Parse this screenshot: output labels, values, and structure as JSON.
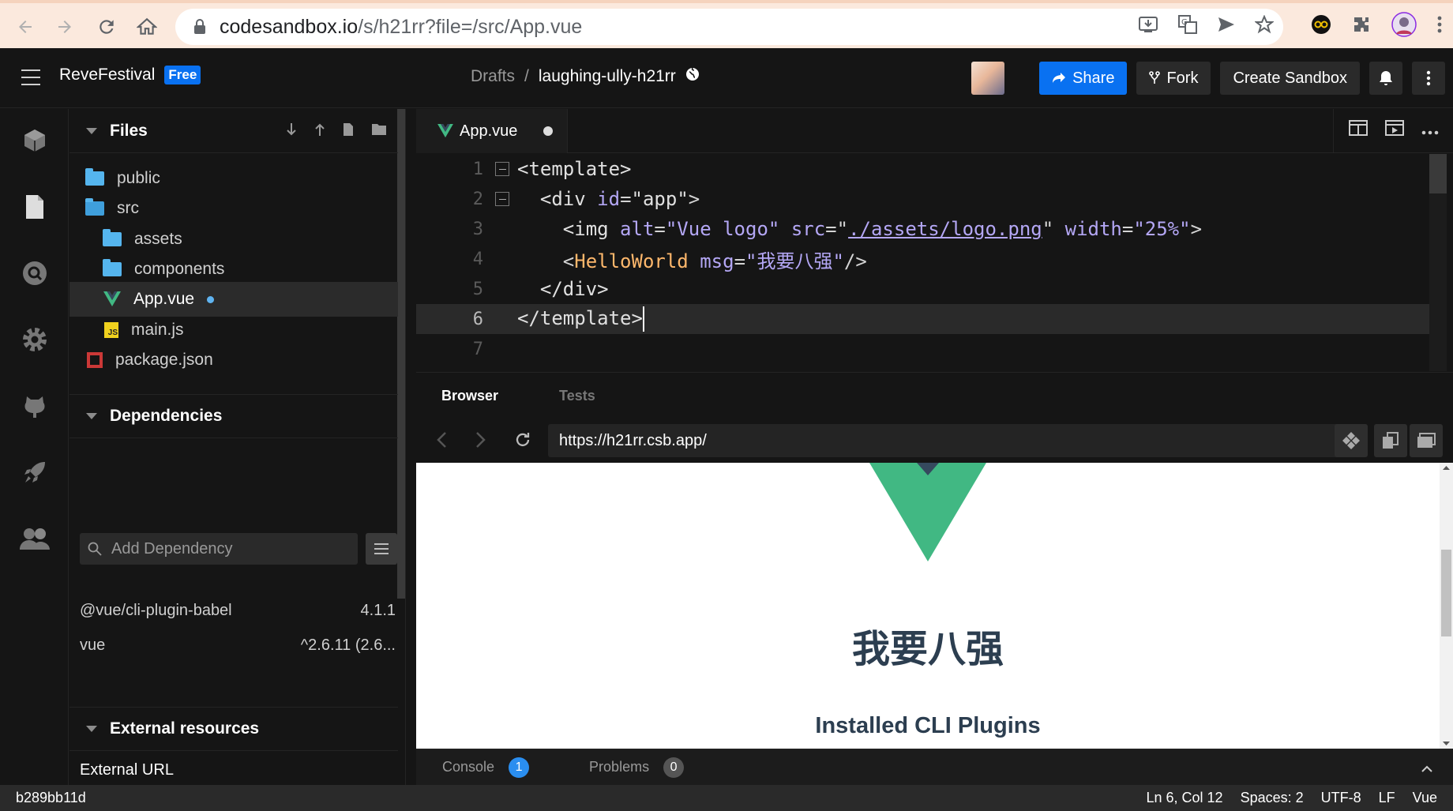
{
  "browser": {
    "url_host": "codesandbox.io",
    "url_path": "/s/h21rr?file=/src/App.vue"
  },
  "header": {
    "workspace": "ReveFestival",
    "plan_badge": "Free",
    "breadcrumb_root": "Drafts",
    "breadcrumb_sep": "/",
    "sandbox_name": "laughing-ully-h21rr",
    "share_label": "Share",
    "fork_label": "Fork",
    "create_label": "Create Sandbox"
  },
  "sidebar": {
    "files_title": "Files",
    "tree": [
      {
        "name": "public",
        "type": "folder"
      },
      {
        "name": "src",
        "type": "folder-open"
      },
      {
        "name": "assets",
        "type": "folder"
      },
      {
        "name": "components",
        "type": "folder"
      },
      {
        "name": "App.vue",
        "type": "vue"
      },
      {
        "name": "main.js",
        "type": "js"
      },
      {
        "name": "package.json",
        "type": "package"
      }
    ],
    "dependencies_title": "Dependencies",
    "dep_placeholder": "Add Dependency",
    "dependencies": [
      {
        "name": "@vue/cli-plugin-babel",
        "version": "4.1.1"
      },
      {
        "name": "vue",
        "version": "^2.6.11 (2.6..."
      }
    ],
    "external_title": "External resources",
    "external_url_label": "External URL"
  },
  "editor": {
    "tab_label": "App.vue",
    "line_numbers": [
      "1",
      "2",
      "3",
      "4",
      "5",
      "6",
      "7"
    ],
    "code": {
      "l1": "<template>",
      "l2_open": "<div",
      "l2_attr": "id",
      "l2_val": "\"app\"",
      "l3_open": "<img",
      "l3_attr1": "alt",
      "l3_val1": "\"Vue logo\"",
      "l3_attr2": "src",
      "l3_val2": "./assets/logo.png",
      "l3_attr3": "width",
      "l3_val3": "\"25%\"",
      "l4_comp": "HelloWorld",
      "l4_attr": "msg",
      "l4_val": "\"我要八强\"",
      "l5": "</div>",
      "l6": "</template>"
    }
  },
  "preview": {
    "tab_browser": "Browser",
    "tab_tests": "Tests",
    "address": "https://h21rr.csb.app/",
    "heading": "我要八强",
    "subheading": "Installed CLI Plugins"
  },
  "console": {
    "console_label": "Console",
    "console_count": "1",
    "problems_label": "Problems",
    "problems_count": "0"
  },
  "status": {
    "commit": "b289bb11d",
    "cursor_pos": "Ln 6, Col 12",
    "spaces": "Spaces: 2",
    "encoding": "UTF-8",
    "eol": "LF",
    "language": "Vue"
  },
  "colors": {
    "accent_blue": "#0971f1",
    "vue_green": "#41b883",
    "vue_dark": "#35495e"
  }
}
